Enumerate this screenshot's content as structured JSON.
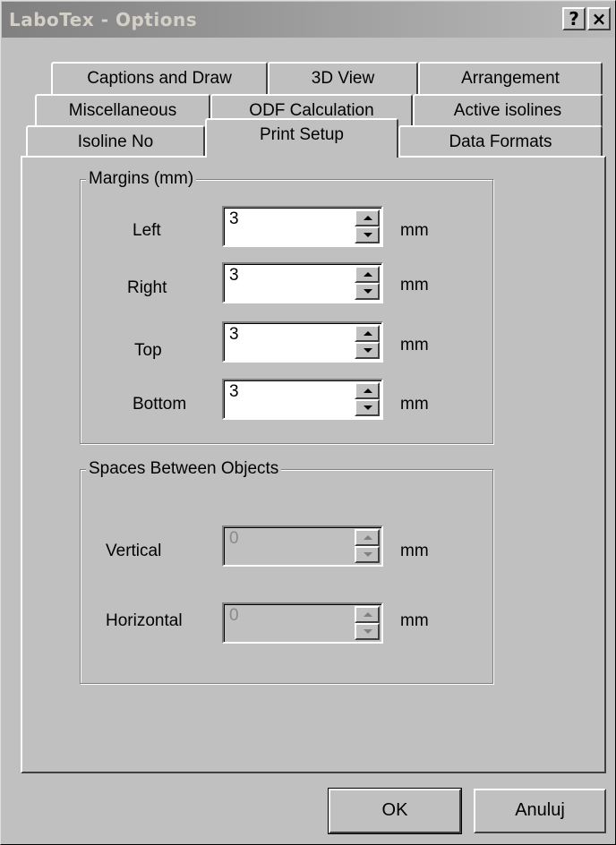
{
  "window": {
    "title": "LaboTex - Options",
    "help_label": "?",
    "close_label": "×"
  },
  "tabs": {
    "row1": [
      "Captions and Draw",
      "3D View",
      "Arrangement"
    ],
    "row2": [
      "Miscellaneous",
      "ODF Calculation",
      "Active isolines"
    ],
    "row3": [
      "Isoline No",
      "Print Setup",
      "Data Formats"
    ],
    "active": "Print Setup"
  },
  "margins": {
    "title": "Margins (mm)",
    "unit": "mm",
    "fields": [
      {
        "label": "Left",
        "value": "3"
      },
      {
        "label": "Right",
        "value": "3"
      },
      {
        "label": "Top",
        "value": "3"
      },
      {
        "label": "Bottom",
        "value": "3"
      }
    ]
  },
  "spaces": {
    "title": "Spaces Between Objects",
    "unit": "mm",
    "fields": [
      {
        "label": "Vertical",
        "value": "0",
        "enabled": false
      },
      {
        "label": "Horizontal",
        "value": "0",
        "enabled": false
      }
    ]
  },
  "buttons": {
    "ok": "OK",
    "cancel": "Anuluj"
  }
}
